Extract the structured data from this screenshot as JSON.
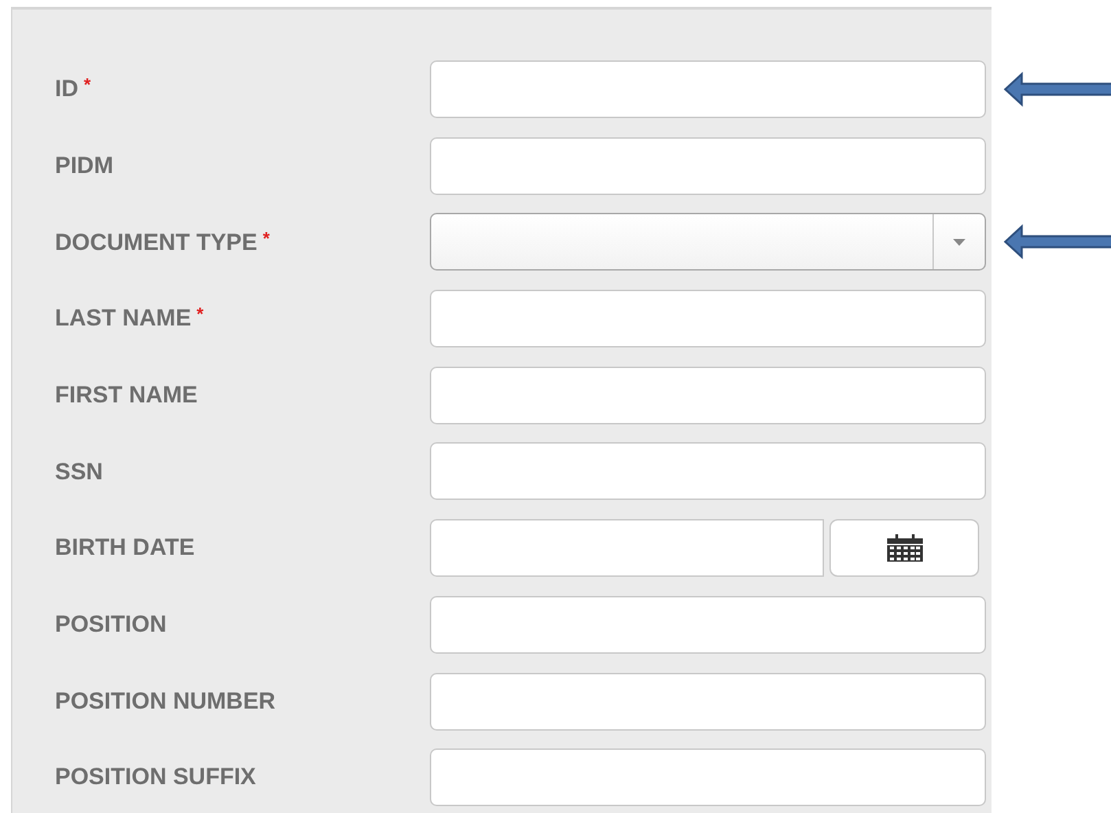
{
  "fields": [
    {
      "label": "ID",
      "required_mark": "*",
      "kind": "text",
      "arrow": true
    },
    {
      "label": "PIDM",
      "kind": "text",
      "arrow": false
    },
    {
      "label": "DOCUMENT TYPE",
      "required_mark": "*",
      "kind": "select",
      "arrow": true
    },
    {
      "label": "LAST NAME",
      "required_mark": "*",
      "kind": "text",
      "arrow": false
    },
    {
      "label": "FIRST NAME",
      "kind": "text",
      "arrow": false
    },
    {
      "label": "SSN",
      "kind": "text",
      "arrow": false
    },
    {
      "label": "BIRTH DATE",
      "kind": "date",
      "arrow": false
    },
    {
      "label": "POSITION",
      "kind": "text",
      "arrow": false
    },
    {
      "label": "POSITION NUMBER",
      "kind": "text",
      "arrow": false
    },
    {
      "label": "POSITION SUFFIX",
      "kind": "text",
      "arrow": false
    }
  ]
}
